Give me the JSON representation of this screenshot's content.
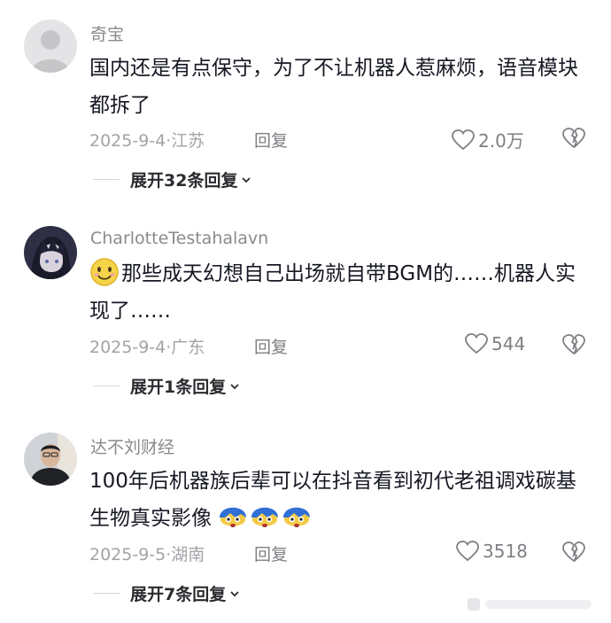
{
  "comments": [
    {
      "username": "奇宝",
      "text": "国内还是有点保守，为了不让机器人惹麻烦，语音模块都拆了",
      "date_location": "2025-9-4·江苏",
      "reply_label": "回复",
      "likes": "2.0万",
      "expand_label": "展开32条回复"
    },
    {
      "username": "CharlotteTestahalavn",
      "text": "那些成天幻想自己出场就自带BGM的……机器人实现了……",
      "date_location": "2025-9-4·广东",
      "reply_label": "回复",
      "likes": "544",
      "expand_label": "展开1条回复"
    },
    {
      "username": "达不刘财经",
      "text": "100年后机器族后辈可以在抖音看到初代老祖调戏碳基生物真实影像",
      "date_location": "2025-9-5·湖南",
      "reply_label": "回复",
      "likes": "3518",
      "expand_label": "展开7条回复"
    }
  ],
  "colors": {
    "text": "#161823",
    "meta": "#a3a3a8",
    "username": "#8a8a8f"
  }
}
